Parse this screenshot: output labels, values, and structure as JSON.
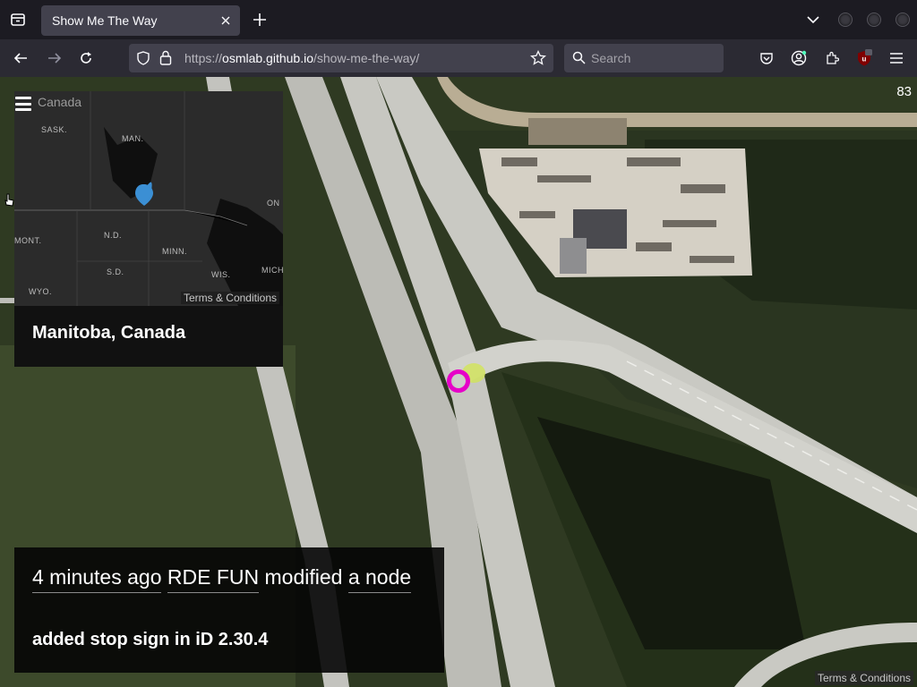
{
  "browser": {
    "tab_title": "Show Me The Way",
    "url_scheme": "https://",
    "url_host": "osmlab.github.io",
    "url_path": "/show-me-the-way/",
    "search_placeholder": "Search"
  },
  "map": {
    "counter": "83",
    "terms_label": "Terms & Conditions",
    "node_marker_color": "#e600c8"
  },
  "minimap": {
    "country_label": "Canada",
    "place_labels": [
      "SASK.",
      "MAN.",
      "ON",
      "N.D.",
      "MONT.",
      "MINN.",
      "S.D.",
      "WIS.",
      "MICH",
      "WYO."
    ],
    "terms_label": "Terms & Conditions",
    "pin_color": "#3b8fd4"
  },
  "location": "Manitoba, Canada",
  "change": {
    "time": "4 minutes ago",
    "user": "RDE FUN",
    "action": "modified",
    "object": "a node",
    "comment": "added stop sign in iD 2.30.4"
  }
}
